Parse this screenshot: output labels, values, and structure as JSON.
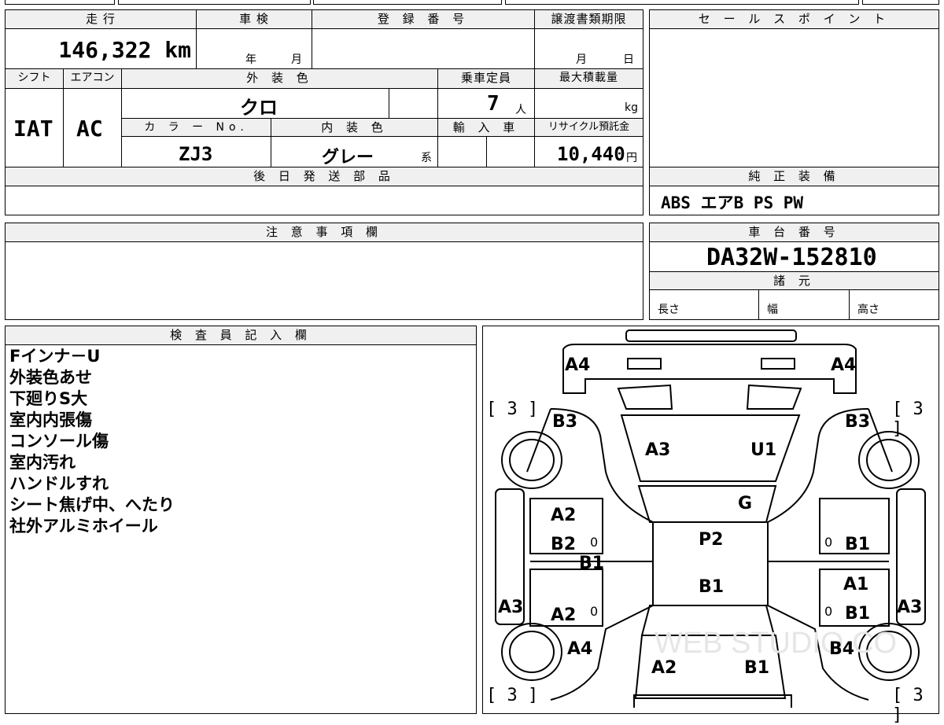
{
  "header": {
    "mileage_label": "走 行",
    "mileage_value": "146,322 km",
    "shaken_label": "車 検",
    "shaken_year": "年",
    "shaken_month": "月",
    "reg_label": "登 録 番 号",
    "transfer_label": "譲渡書類期限",
    "transfer_month": "月",
    "transfer_day": "日",
    "sales_label": "セ ー ル ス ポ イ ン ト"
  },
  "specs": {
    "shift_label": "シフト",
    "shift_value": "IAT",
    "ac_label": "エアコン",
    "ac_value": "AC",
    "color_label": "外 装 色",
    "color_value": "クロ",
    "capacity_label": "乗車定員",
    "capacity_value": "7",
    "capacity_unit": "人",
    "load_label": "最大積載量",
    "load_unit": "kg",
    "color_no_label": "カ ラ ー No.",
    "color_no_value": "ZJ3",
    "interior_label": "内 装 色",
    "interior_value": "グレー",
    "interior_suffix": "系",
    "import_label": "輸 入 車",
    "recycle_label": "リサイクル預託金",
    "recycle_value": "10,440",
    "recycle_unit": "円"
  },
  "parts": {
    "label": "後 日 発 送 部 品"
  },
  "equipment": {
    "label": "純 正 装 備",
    "value": "ABS エアB PS PW"
  },
  "caution": {
    "label": "注 意 事 項 欄"
  },
  "chassis": {
    "label": "車 台 番 号",
    "value": "DA32W-152810"
  },
  "dims": {
    "label": "諸 元",
    "length": "長さ",
    "width": "幅",
    "height": "高さ"
  },
  "inspector": {
    "label": "検 査 員 記 入 欄",
    "notes": [
      "Fインナ－U",
      "外装色あせ",
      "下廻りS大",
      "室内内張傷",
      "コンソール傷",
      "室内汚れ",
      "ハンドルすれ",
      "シート焦げ中、へたり",
      "社外アルミホイール"
    ]
  },
  "diagram": {
    "marks": {
      "a4_left": "A4",
      "a4_right": "A4",
      "b3_left": "B3",
      "b3_right": "B3",
      "a3_hood": "A3",
      "u1_hood": "U1",
      "g_glass": "G",
      "a2_front_left": "A2",
      "b2_left": "B2",
      "b1_left_mid": "B1",
      "p2_roof": "P2",
      "b1_roof": "B1",
      "b1_right_front": "B1",
      "a1_right": "A1",
      "b1_right_rear": "B1",
      "a3_left_side": "A3",
      "a3_right_side": "A3",
      "a2_rear_left": "A2",
      "a4_rear_left": "A4",
      "b4_rear_right": "B4",
      "a2_rear": "A2",
      "b1_rear": "B1"
    },
    "tires": {
      "fl": "3",
      "fr": "3",
      "rl": "3",
      "rr": "3"
    },
    "small_marks": {
      "l1": "0",
      "l2": "0",
      "r1": "0",
      "r2": "0"
    },
    "watermark": "WEB STUDIO CO"
  }
}
